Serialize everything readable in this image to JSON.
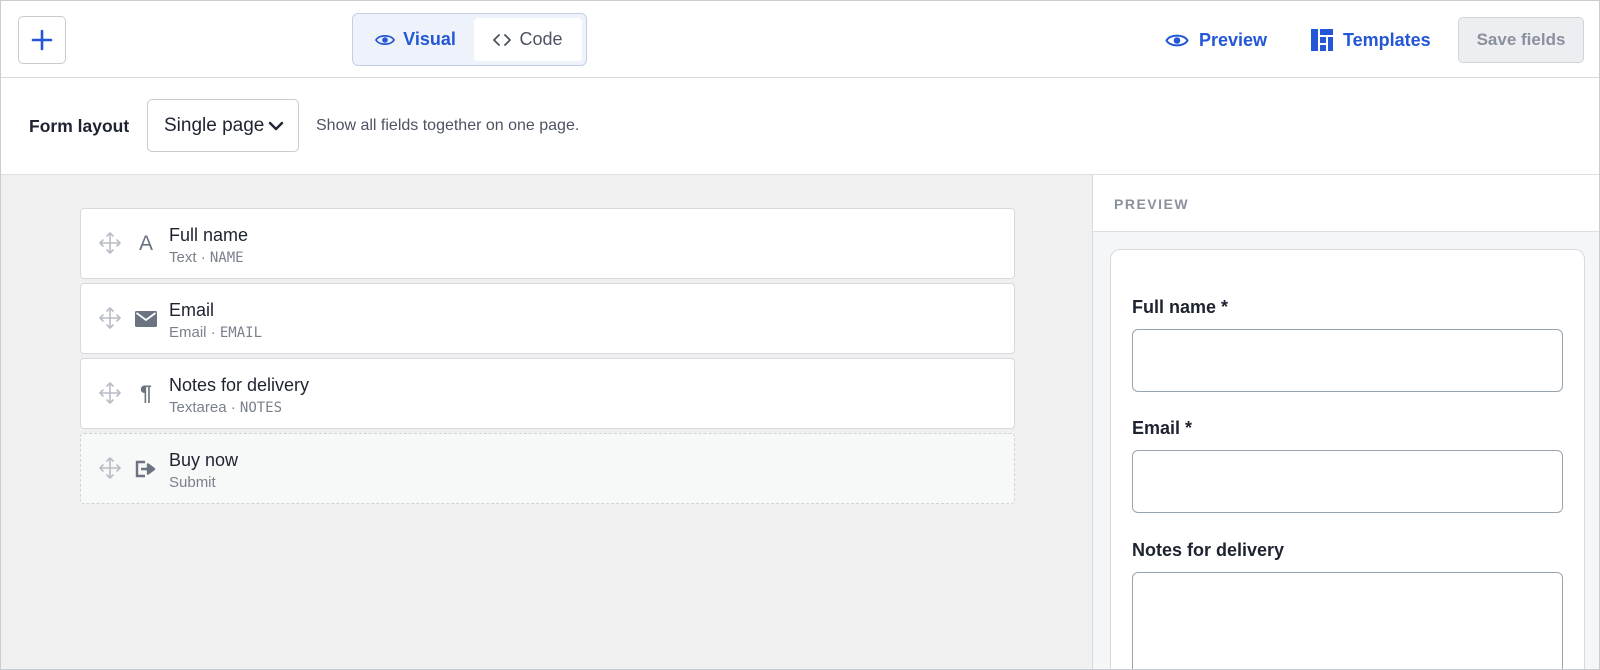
{
  "toolbar": {
    "add_label": "+",
    "modes": [
      {
        "label": "Visual",
        "active": true
      },
      {
        "label": "Code",
        "active": false
      }
    ],
    "preview_label": "Preview",
    "templates_label": "Templates",
    "save_label": "Save fields"
  },
  "layout": {
    "label": "Form layout",
    "selected": "Single page",
    "help": "Show all fields together on one page."
  },
  "fields": [
    {
      "title": "Full name",
      "type": "Text",
      "key": "NAME",
      "icon": "text-icon"
    },
    {
      "title": "Email",
      "type": "Email",
      "key": "EMAIL",
      "icon": "envelope-icon"
    },
    {
      "title": "Notes for delivery",
      "type": "Textarea",
      "key": "NOTES",
      "icon": "pilcrow-icon"
    },
    {
      "title": "Buy now",
      "type": "Submit",
      "key": "",
      "icon": "submit-icon"
    }
  ],
  "text_icon_glyph": "A",
  "pilcrow_glyph": "¶",
  "separator": "·",
  "preview": {
    "header": "PREVIEW",
    "fields": [
      {
        "label": "Full name *"
      },
      {
        "label": "Email *"
      },
      {
        "label": "Notes for delivery"
      }
    ]
  },
  "colors": {
    "accent": "#2457d6",
    "canvas_bg": "#f0f0f0",
    "muted_text": "#7a808c"
  }
}
